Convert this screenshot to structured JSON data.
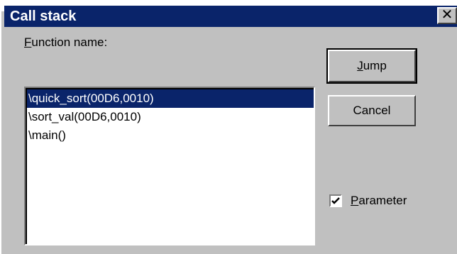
{
  "dialog": {
    "title": "Call stack",
    "close_glyph": "✕"
  },
  "function_label": {
    "accel": "F",
    "rest": "unction name:"
  },
  "call_stack": [
    {
      "text": "\\quick_sort(00D6,0010)",
      "selected": true
    },
    {
      "text": "\\sort_val(00D6,0010)",
      "selected": false
    },
    {
      "text": "\\main()",
      "selected": false
    }
  ],
  "buttons": {
    "jump": {
      "accel": "J",
      "rest": "ump"
    },
    "cancel": {
      "label": "Cancel"
    }
  },
  "parameter": {
    "accel": "P",
    "rest": "arameter",
    "checked": true
  },
  "colors": {
    "title_bg": "#0a246a",
    "selection_bg": "#0a246a",
    "face": "#c0c0c0"
  }
}
